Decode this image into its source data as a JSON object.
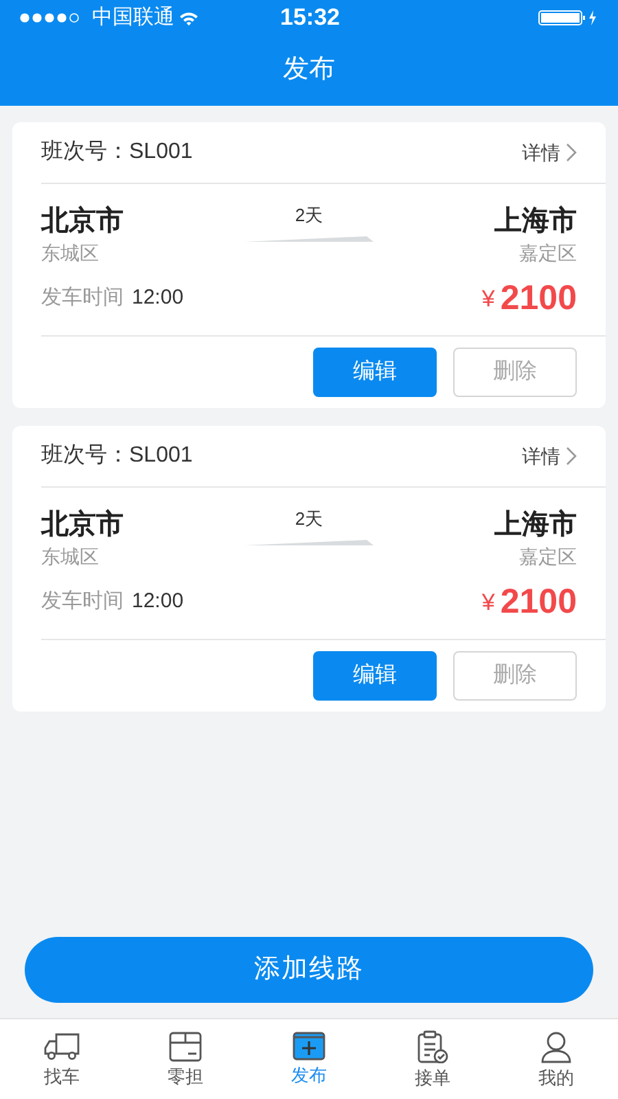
{
  "status_bar": {
    "carrier": "中国联通",
    "time": "15:32"
  },
  "title": "发布",
  "routes": [
    {
      "number_label": "班次号：",
      "number": "SL001",
      "details": "详情",
      "from_city": "北京市",
      "from_district": "东城区",
      "duration": "2天",
      "to_city": "上海市",
      "to_district": "嘉定区",
      "depart_label": "发车时间",
      "depart_time": "12:00",
      "currency": "¥",
      "price": "2100",
      "edit": "编辑",
      "delete": "删除"
    },
    {
      "number_label": "班次号：",
      "number": "SL001",
      "details": "详情",
      "from_city": "北京市",
      "from_district": "东城区",
      "duration": "2天",
      "to_city": "上海市",
      "to_district": "嘉定区",
      "depart_label": "发车时间",
      "depart_time": "12:00",
      "currency": "¥",
      "price": "2100",
      "edit": "编辑",
      "delete": "删除"
    }
  ],
  "add_button": "添加线路",
  "tabs": [
    {
      "kind": "truck",
      "label": "找车",
      "selected": false
    },
    {
      "kind": "box",
      "label": "零担",
      "selected": false
    },
    {
      "kind": "publish",
      "label": "发布",
      "selected": true
    },
    {
      "kind": "clipboard",
      "label": "接单",
      "selected": false
    },
    {
      "kind": "person",
      "label": "我的",
      "selected": false
    }
  ]
}
